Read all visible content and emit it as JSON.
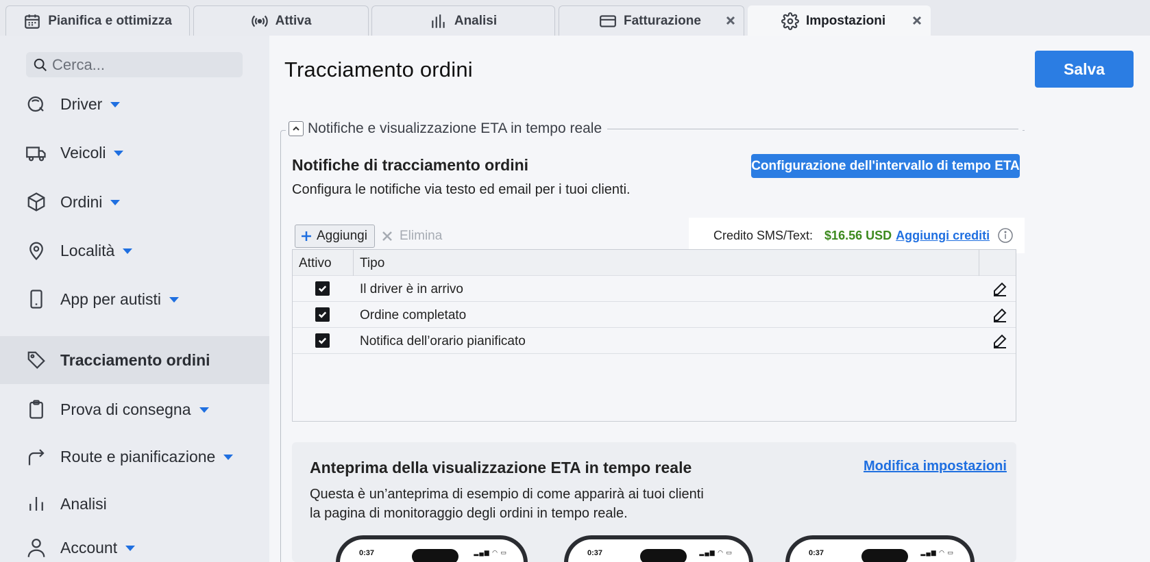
{
  "tabs": [
    {
      "label": "Pianifica e ottimizza",
      "icon": "calendar-icon"
    },
    {
      "label": "Attiva",
      "icon": "broadcast-icon"
    },
    {
      "label": "Analisi",
      "icon": "bar-chart-icon"
    },
    {
      "label": "Fatturazione",
      "icon": "credit-card-icon"
    },
    {
      "label": "Impostazioni",
      "icon": "gear-icon"
    }
  ],
  "search": {
    "placeholder": "Cerca..."
  },
  "sidebar": {
    "items": [
      {
        "label": "Driver",
        "icon": "driver-icon"
      },
      {
        "label": "Veicoli",
        "icon": "truck-icon"
      },
      {
        "label": "Ordini",
        "icon": "package-icon"
      },
      {
        "label": "Località",
        "icon": "map-pin-icon"
      },
      {
        "label": "App per autisti",
        "icon": "phone-icon"
      },
      {
        "label": "Tracciamento ordini",
        "icon": "tag-icon",
        "active": true
      },
      {
        "label": "Prova di consegna",
        "icon": "clipboard-icon"
      },
      {
        "label": "Route e pianificazione",
        "icon": "route-icon"
      },
      {
        "label": "Analisi",
        "icon": "analytics-icon"
      },
      {
        "label": "Account",
        "icon": "user-icon"
      }
    ]
  },
  "main": {
    "title": "Tracciamento ordini",
    "save_label": "Salva",
    "section_legend": "Notifiche e visualizzazione ETA in tempo reale",
    "notifications": {
      "title": "Notifiche di tracciamento ordini",
      "description": "Configura le notifiche via testo ed email per i tuoi clienti.",
      "eta_button": "Configurazione dell'intervallo di tempo ETA",
      "add_label": "Aggiungi",
      "delete_label": "Elimina",
      "credit_label": "Credito SMS/Text:",
      "credit_value": "$16.56 USD",
      "add_credits_label": "Aggiungi crediti",
      "columns": {
        "active": "Attivo",
        "type": "Tipo"
      },
      "rows": [
        {
          "active": true,
          "type": "Il driver è in arrivo"
        },
        {
          "active": true,
          "type": "Ordine completato"
        },
        {
          "active": true,
          "type": "Notifica dell’orario pianificato"
        }
      ]
    },
    "preview": {
      "title": "Anteprima della visualizzazione ETA in tempo reale",
      "description_line1": "Questa è un’anteprima di esempio di come apparirà ai tuoi clienti",
      "description_line2": "la pagina di monitoraggio degli ordini in tempo reale.",
      "edit_link": "Modifica impostazioni",
      "phone_time": "0:37"
    }
  },
  "colors": {
    "accent": "#2b7de3",
    "credit": "#3d8a1f"
  }
}
